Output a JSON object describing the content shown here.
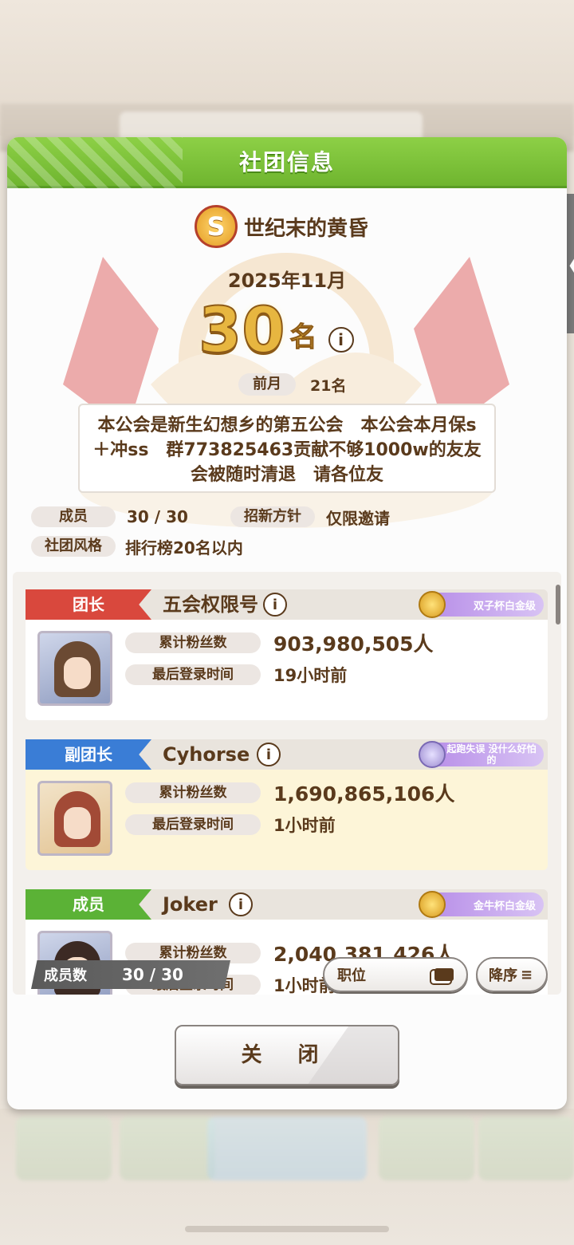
{
  "dialog": {
    "title": "社团信息",
    "close_label": "关 闭"
  },
  "guild": {
    "badge_letter": "S",
    "name": "世纪末的黄昏",
    "month": "2025年11月",
    "rank_number": "30",
    "rank_unit": "名",
    "info_glyph": "i",
    "prev_label": "前月",
    "prev_value": "21名",
    "description": "本公会是新生幻想乡的第五公会　本公会本月保s＋冲ss　群773825463贡献不够1000w的友友会被随时清退　请各位友",
    "members_label": "成员",
    "members_value": "30 / 30",
    "policy_label": "招新方针",
    "policy_value": "仅限邀请",
    "style_label": "社团风格",
    "style_value": "排行榜20名以内"
  },
  "members": [
    {
      "role": "团长",
      "role_color": "#d9483d",
      "name": "五会权限号",
      "title": "双子杯白金级",
      "fans_label": "累计粉丝数",
      "fans": "903,980,505人",
      "login_label": "最后登录时间",
      "login": "19小时前"
    },
    {
      "role": "副团长",
      "role_color": "#3a7dd6",
      "name": "Cyhorse",
      "title": "起跑失误 没什么好怕的",
      "fans_label": "累计粉丝数",
      "fans": "1,690,865,106人",
      "login_label": "最后登录时间",
      "login": "1小时前"
    },
    {
      "role": "成员",
      "role_color": "#5bb236",
      "name": "Joker",
      "title": "金牛杯白金级",
      "fans_label": "累计粉丝数",
      "fans": "2,040,381,426人",
      "login_label": "最后登录时间",
      "login": "1小时前"
    }
  ],
  "footer": {
    "count_label": "成员数",
    "count_value": "30 / 30",
    "role_button": "职位",
    "sort_button": "降序",
    "sort_icon": "≡"
  },
  "side_tab": {
    "glyph": "〈"
  }
}
